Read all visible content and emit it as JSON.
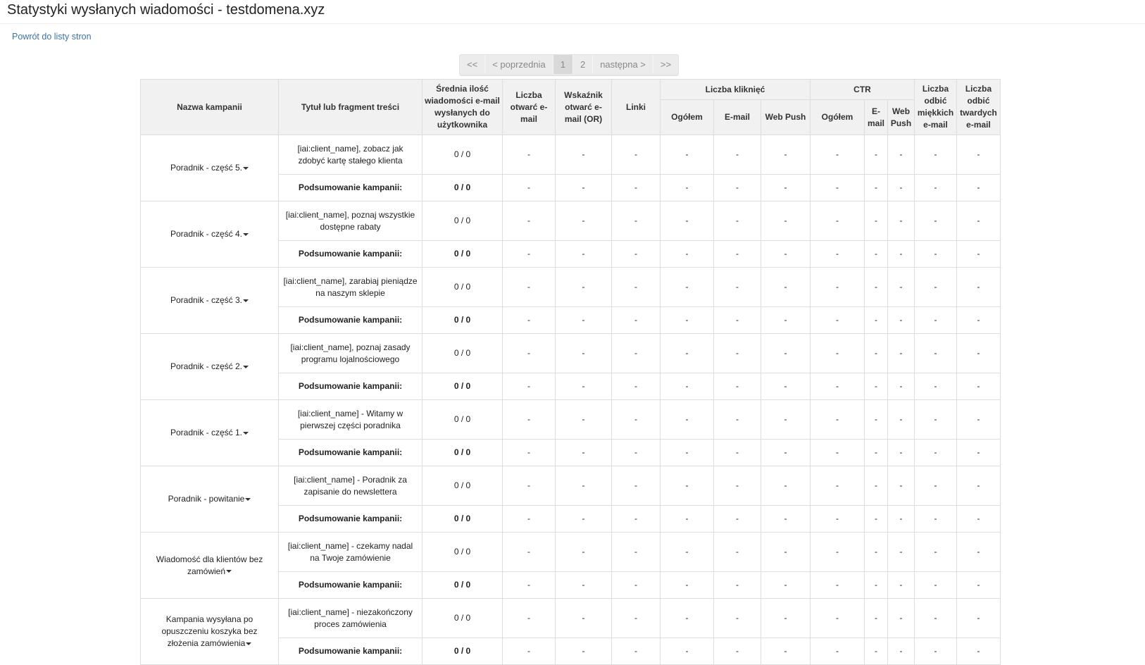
{
  "page": {
    "title": "Statystyki wysłanych wiadomości - testdomena.xyz",
    "back_link": "Powrót do listy stron"
  },
  "pagination": {
    "first": "<<",
    "prev": "< poprzednia",
    "page1": "1",
    "page2": "2",
    "next": "następna >",
    "last": ">>"
  },
  "table": {
    "headers": {
      "campaign": "Nazwa kampanii",
      "title": "Tytuł lub fragment treści",
      "avg_sent": "Średnia ilość wiadomości e-mail wysłanych do użytkownika",
      "opens": "Liczba otwarć e-mail",
      "open_rate": "Wskaźnik otwarć e-mail (OR)",
      "links": "Linki",
      "clicks_group": "Liczba kliknięć",
      "clicks_total": "Ogółem",
      "clicks_email": "E-mail",
      "clicks_webpush": "Web Push",
      "ctr_group": "CTR",
      "ctr_total": "Ogółem",
      "ctr_email": "E-mail",
      "ctr_webpush": "Web Push",
      "soft_bounces": "Liczba odbić miękkich e-mail",
      "hard_bounces": "Liczba odbić twardych e-mail"
    },
    "summary_label": "Podsumowanie kampanii:",
    "empty": "-",
    "campaigns": [
      {
        "name": "Poradnik - część 5.",
        "message": "[iai:client_name], zobacz jak zdobyć kartę stałego klienta",
        "sent": "0 / 0",
        "summary_sent": "0 / 0"
      },
      {
        "name": "Poradnik - część 4.",
        "message": "[iai:client_name], poznaj wszystkie dostępne rabaty",
        "sent": "0 / 0",
        "summary_sent": "0 / 0"
      },
      {
        "name": "Poradnik - część 3.",
        "message": "[iai:client_name], zarabiaj pieniądze na naszym sklepie",
        "sent": "0 / 0",
        "summary_sent": "0 / 0"
      },
      {
        "name": "Poradnik - część 2.",
        "message": "[iai:client_name], poznaj zasady programu lojalnościowego",
        "sent": "0 / 0",
        "summary_sent": "0 / 0"
      },
      {
        "name": "Poradnik - część 1.",
        "message": "[iai:client_name] - Witamy w pierwszej części poradnika",
        "sent": "0 / 0",
        "summary_sent": "0 / 0"
      },
      {
        "name": "Poradnik - powitanie",
        "message": "[iai:client_name] - Poradnik za zapisanie do newslettera",
        "sent": "0 / 0",
        "summary_sent": "0 / 0"
      },
      {
        "name": "Wiadomość dla klientów bez zamówień",
        "message": "[iai:client_name] - czekamy nadal na Twoje zamówienie",
        "sent": "0 / 0",
        "summary_sent": "0 / 0"
      },
      {
        "name": "Kampania wysyłana po opuszczeniu koszyka bez złożenia zamówienia",
        "message": "[iai:client_name] - niezakończony proces zamówienia",
        "sent": "0 / 0",
        "summary_sent": "0 / 0"
      }
    ]
  }
}
